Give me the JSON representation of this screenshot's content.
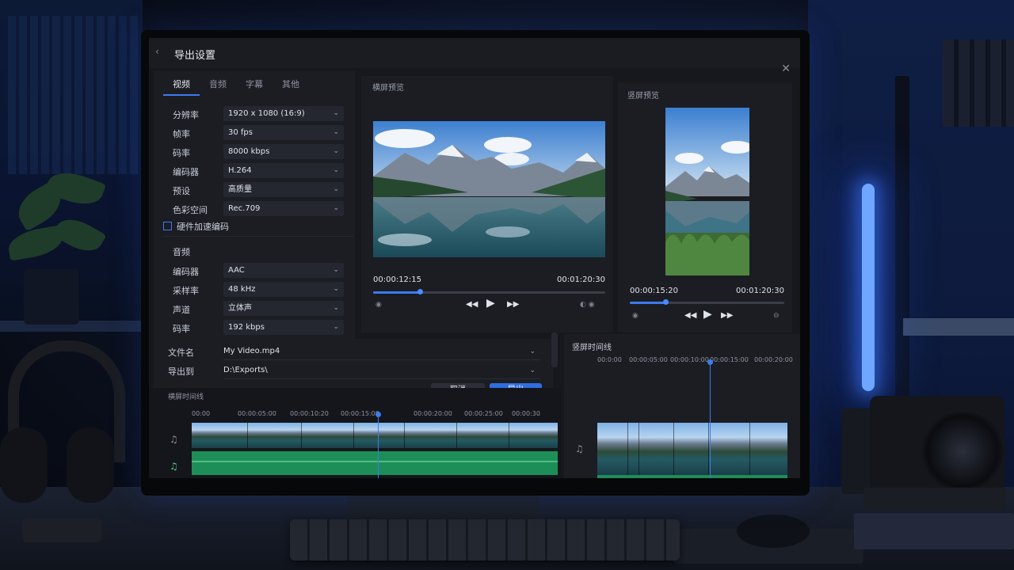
{
  "window": {
    "title": "导出设置",
    "back_icon": "chevron-left-icon",
    "close_icon": "close-icon"
  },
  "settings": {
    "tabs": [
      {
        "label": "视频",
        "active": true
      },
      {
        "label": "音频",
        "active": false
      },
      {
        "label": "字幕",
        "active": false
      },
      {
        "label": "其他",
        "active": false
      }
    ],
    "video": {
      "resolution": {
        "label": "分辨率",
        "value": "1920 x 1080 (16:9)"
      },
      "framerate": {
        "label": "帧率",
        "value": "30 fps"
      },
      "bitrate": {
        "label": "码率",
        "value": "8000 kbps"
      },
      "codec": {
        "label": "编码器",
        "value": "H.264"
      },
      "preset": {
        "label": "预设",
        "value": "高质量"
      },
      "colorspace": {
        "label": "色彩空间",
        "value": "Rec.709"
      }
    },
    "hardware_accel": {
      "label": "硬件加速编码",
      "checked": false
    },
    "audio": {
      "section_label": "音频",
      "codec": {
        "label": "编码器",
        "value": "AAC"
      },
      "samplerate": {
        "label": "采样率",
        "value": "48 kHz"
      },
      "channels": {
        "label": "声道",
        "value": "立体声"
      },
      "bitrate": {
        "label": "码率",
        "value": "192 kbps"
      }
    }
  },
  "file": {
    "name_label": "文件名",
    "name_value": "My Video.mp4",
    "dest_label": "导出到",
    "dest_value": "D:\\Exports\\"
  },
  "buttons": {
    "cancel": "取消",
    "export": "导出"
  },
  "landscape_preview": {
    "title": "横屏预览",
    "current_time": "00:00:12:15",
    "total_time": "00:01:20:30",
    "progress": 0.2
  },
  "vertical_preview": {
    "title": "竖屏预览",
    "current_time": "00:00:15:20",
    "total_time": "00:01:20:30",
    "progress": 0.23
  },
  "landscape_timeline": {
    "title": "横屏时间线",
    "ruler": [
      "00:00",
      "00:00:05:00",
      "00:00:10:20",
      "00:00:15:00",
      "00:00:20:00",
      "00:00:25:00",
      "00:00:30"
    ]
  },
  "vertical_timeline": {
    "title": "竖屏时间线",
    "ruler": [
      "00:0:00",
      "00:00:05:00",
      "00:00:10:00",
      "00:00:15:00",
      "00:00:20:00"
    ]
  },
  "colors": {
    "accent": "#2f6ee0",
    "audio_track": "#1e8e58",
    "panel": "#1b1d23"
  }
}
